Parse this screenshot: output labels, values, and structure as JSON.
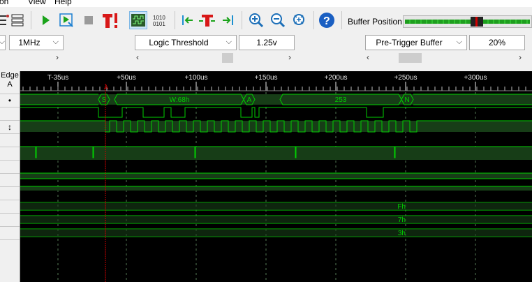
{
  "menu": {
    "items": [
      "on",
      "View",
      "Help"
    ]
  },
  "toolbar": {
    "buffer_position_label": "Buffer Position:",
    "buffer_position_fraction": 0.58
  },
  "controls": {
    "rate_left": "",
    "sample_rate": "1MHz",
    "threshold_mode": "Logic Threshold",
    "threshold_value": "1.25v",
    "trigger_buffer_mode": "Pre-Trigger Buffer",
    "trigger_buffer_value": "20%"
  },
  "channels_header": {
    "line1": "Edge",
    "line2": "A"
  },
  "channel_markers": [
    "•",
    "↕"
  ],
  "timeline": {
    "ticks": [
      "T-35us",
      "+50us",
      "+100us",
      "+150us",
      "+200us",
      "+250us",
      "+300us"
    ],
    "trigger_marker": "A"
  },
  "decode": {
    "labels": [
      "S",
      "W:68h",
      "A",
      "253",
      "N"
    ]
  },
  "bus_values": [
    "Fh",
    "7h",
    "3h"
  ],
  "colors": {
    "wave_bg": "#000000",
    "trace": "#00d000",
    "band": "#173d17",
    "trigger": "#d00000",
    "grid": "#3a6a3a"
  }
}
